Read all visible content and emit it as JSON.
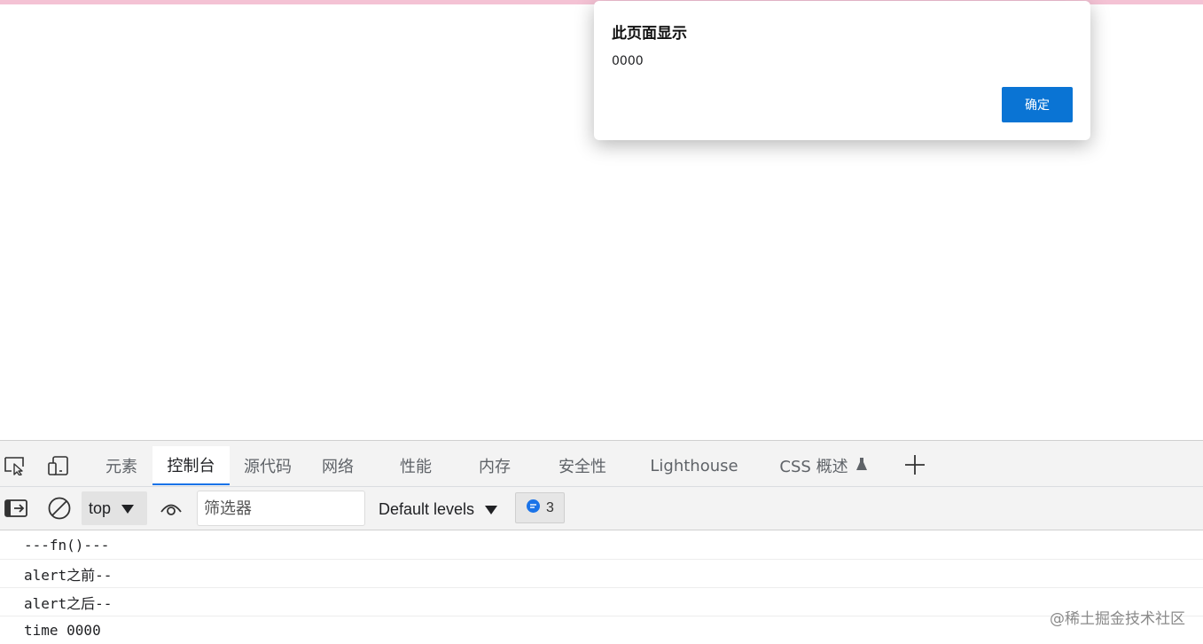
{
  "dialog": {
    "title": "此页面显示",
    "message": "0000",
    "ok_label": "确定"
  },
  "devtools": {
    "tabs": [
      {
        "label": "元素",
        "active": false
      },
      {
        "label": "控制台",
        "active": true
      },
      {
        "label": "源代码",
        "active": false
      },
      {
        "label": "网络",
        "active": false
      },
      {
        "label": "性能",
        "active": false
      },
      {
        "label": "内存",
        "active": false
      },
      {
        "label": "安全性",
        "active": false
      },
      {
        "label": "Lighthouse",
        "active": false
      },
      {
        "label": "CSS 概述",
        "active": false
      }
    ],
    "toolbar": {
      "context": "top",
      "filter_placeholder": "筛选器",
      "levels_label": "Default levels",
      "message_count": "3"
    },
    "console_lines": [
      "---fn()---",
      "alert之前--",
      "alert之后--",
      "time 0000"
    ]
  },
  "watermark": "@稀土掘金技术社区",
  "colors": {
    "accent": "#1a73e8",
    "dialog_button": "#0a74d4",
    "top_strip": "#f4c2d4"
  }
}
